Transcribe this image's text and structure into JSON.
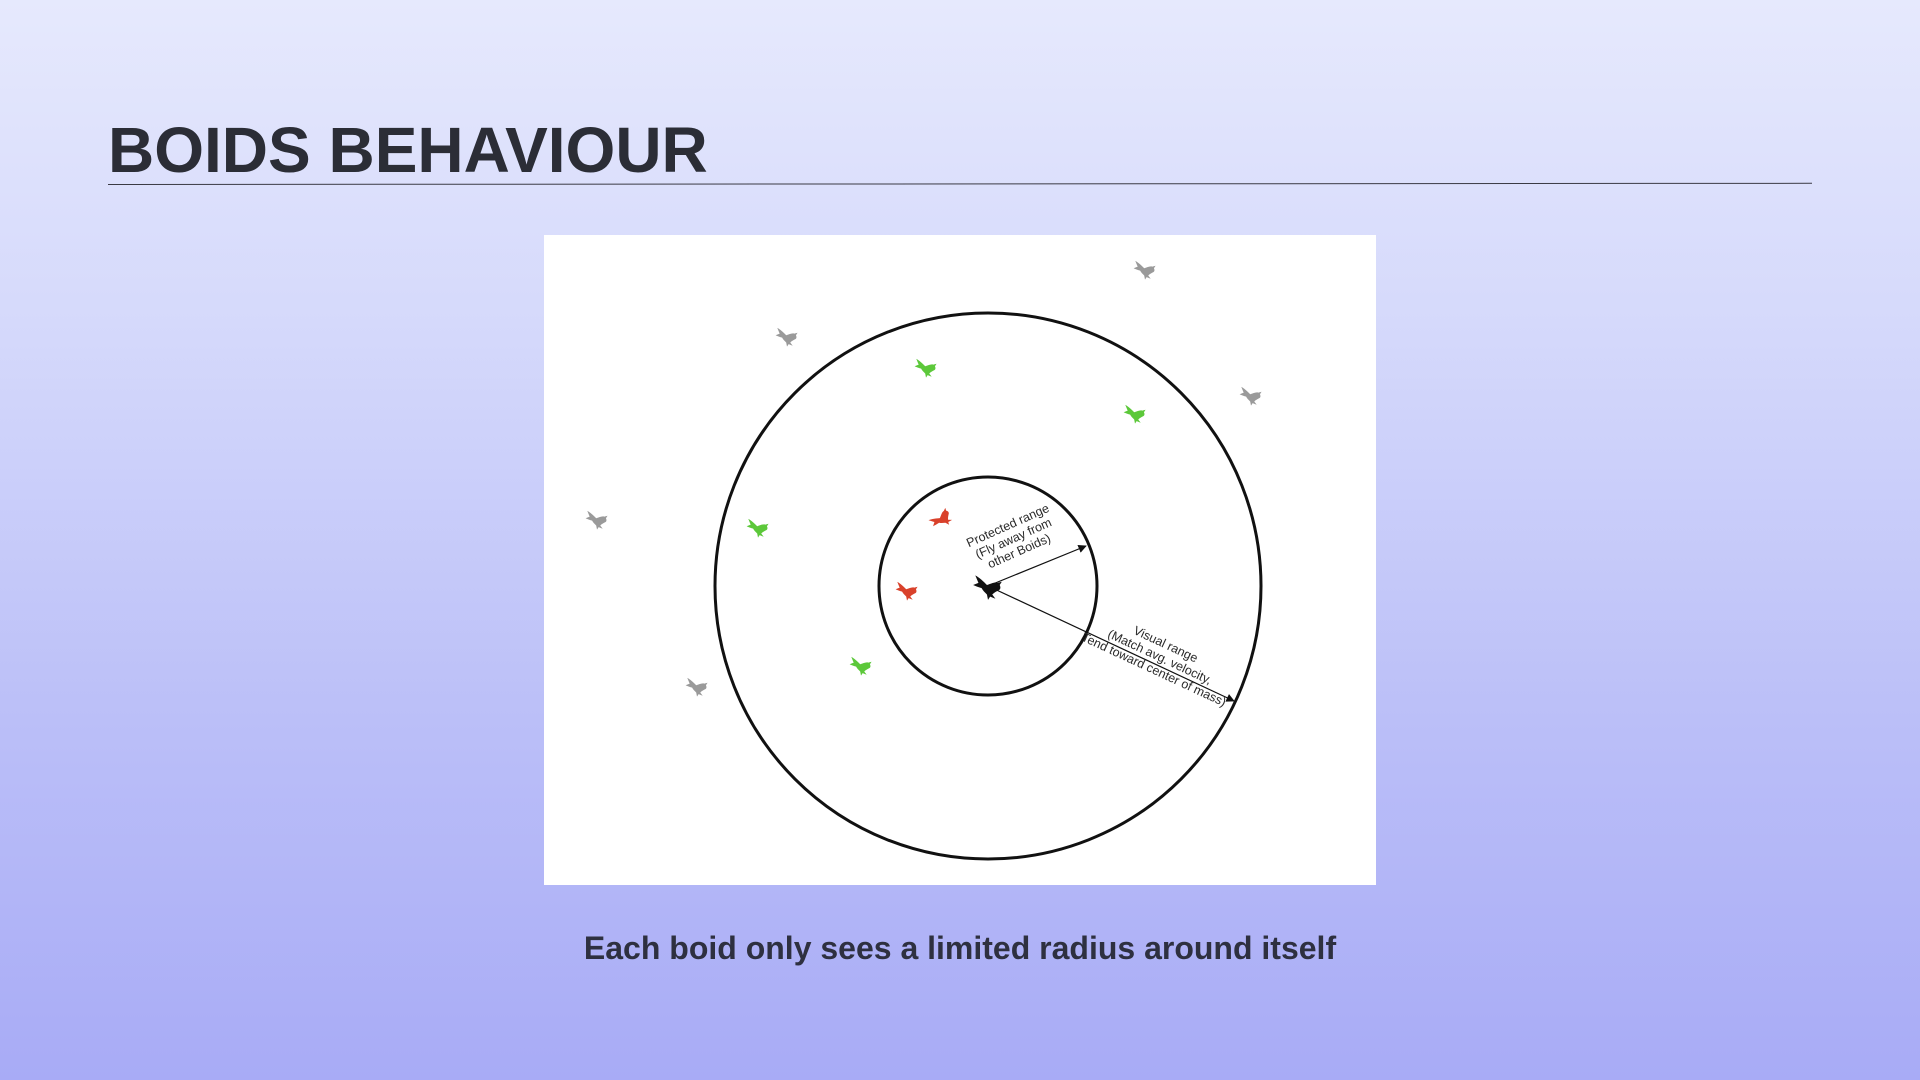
{
  "slide": {
    "title": "BOIDS BEHAVIOUR",
    "caption": "Each boid only sees a limited radius around itself"
  },
  "diagram": {
    "protected_range": {
      "line1": "Protected range",
      "line2": "(Fly away from",
      "line3": "other Boids)"
    },
    "visual_range": {
      "line1": "Visual range",
      "line2": "(Match avg. velocity,",
      "line3": "Tend toward center of mass)"
    },
    "colors": {
      "focal_boid": "#111111",
      "protected_boids": "#d9412b",
      "visible_boids": "#5cc83a",
      "outside_boids": "#9a9a9a",
      "circles": "#111111"
    },
    "icons": {
      "boid": "bird-icon"
    }
  }
}
